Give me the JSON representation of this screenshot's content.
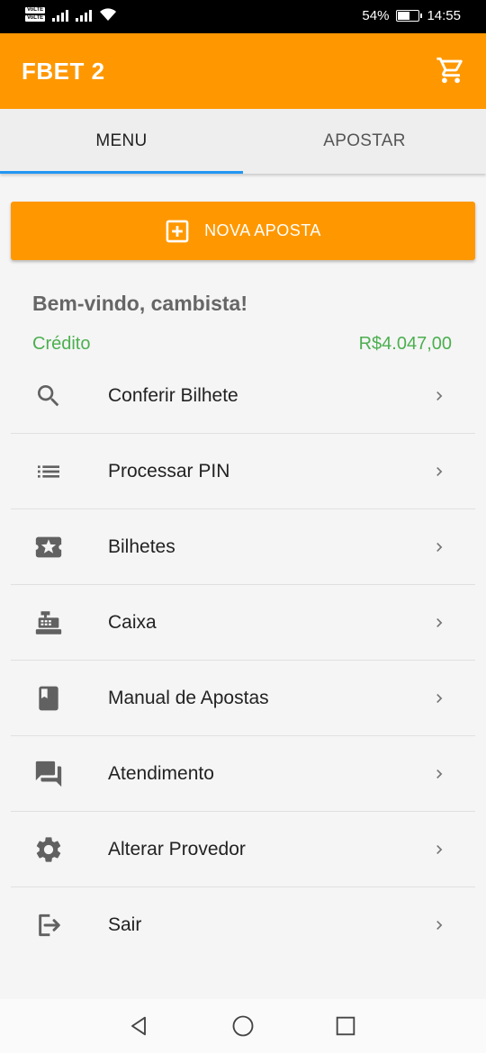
{
  "status_bar": {
    "volte_1": "VoLTE",
    "volte_2": "VoLTE",
    "battery_text": "54%",
    "battery_level": 0.54,
    "time": "14:55",
    "icons": [
      "signal-icon",
      "signal-icon",
      "wifi-icon",
      "battery-icon"
    ]
  },
  "app_bar": {
    "title": "FBET 2",
    "cart_icon": "cart-icon"
  },
  "tabs": [
    {
      "label": "MENU",
      "active": true
    },
    {
      "label": "APOSTAR",
      "active": false
    }
  ],
  "nova_aposta": {
    "label": "NOVA APOSTA",
    "icon": "add-box-icon"
  },
  "welcome": {
    "greeting": "Bem-vindo, cambista!",
    "credit_label": "Crédito",
    "credit_value": "R$4.047,00"
  },
  "menu": {
    "items": [
      {
        "label": "Conferir Bilhete",
        "icon": "search-icon"
      },
      {
        "label": "Processar PIN",
        "icon": "list-icon"
      },
      {
        "label": "Bilhetes",
        "icon": "ticket-star-icon"
      },
      {
        "label": "Caixa",
        "icon": "cash-register-icon"
      },
      {
        "label": "Manual de Apostas",
        "icon": "book-icon"
      },
      {
        "label": "Atendimento",
        "icon": "chat-icon"
      },
      {
        "label": "Alterar Provedor",
        "icon": "gear-icon"
      },
      {
        "label": "Sair",
        "icon": "logout-icon"
      }
    ]
  },
  "colors": {
    "accent": "#ff9800",
    "tab_indicator": "#2196f3",
    "credit": "#4caf50",
    "icon_gray": "#616161"
  },
  "nav_bar": {
    "icons": [
      "back-icon",
      "home-icon",
      "recents-icon"
    ]
  }
}
